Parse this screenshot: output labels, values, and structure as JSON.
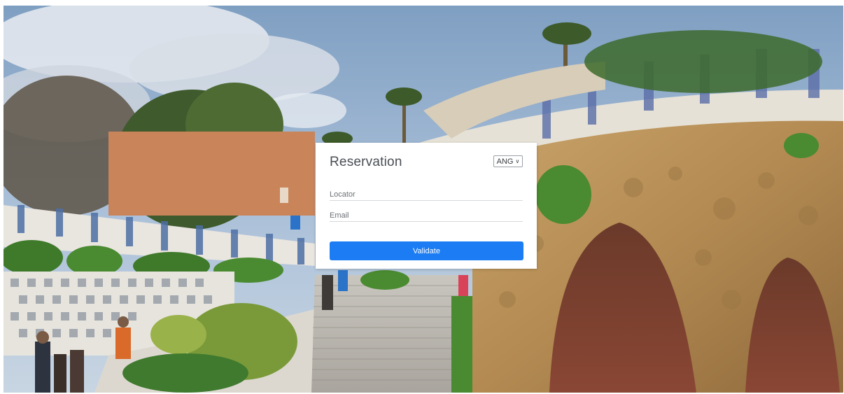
{
  "form": {
    "title": "Reservation",
    "language": "ANG",
    "locator_placeholder": "Locator",
    "email_placeholder": "Email",
    "submit_label": "Validate"
  },
  "icons": {
    "language_dropdown": "chevron-down-icon"
  },
  "colors": {
    "accent": "#1b7cf3",
    "card_background": "#ffffff",
    "title_text": "#4a4f55"
  }
}
